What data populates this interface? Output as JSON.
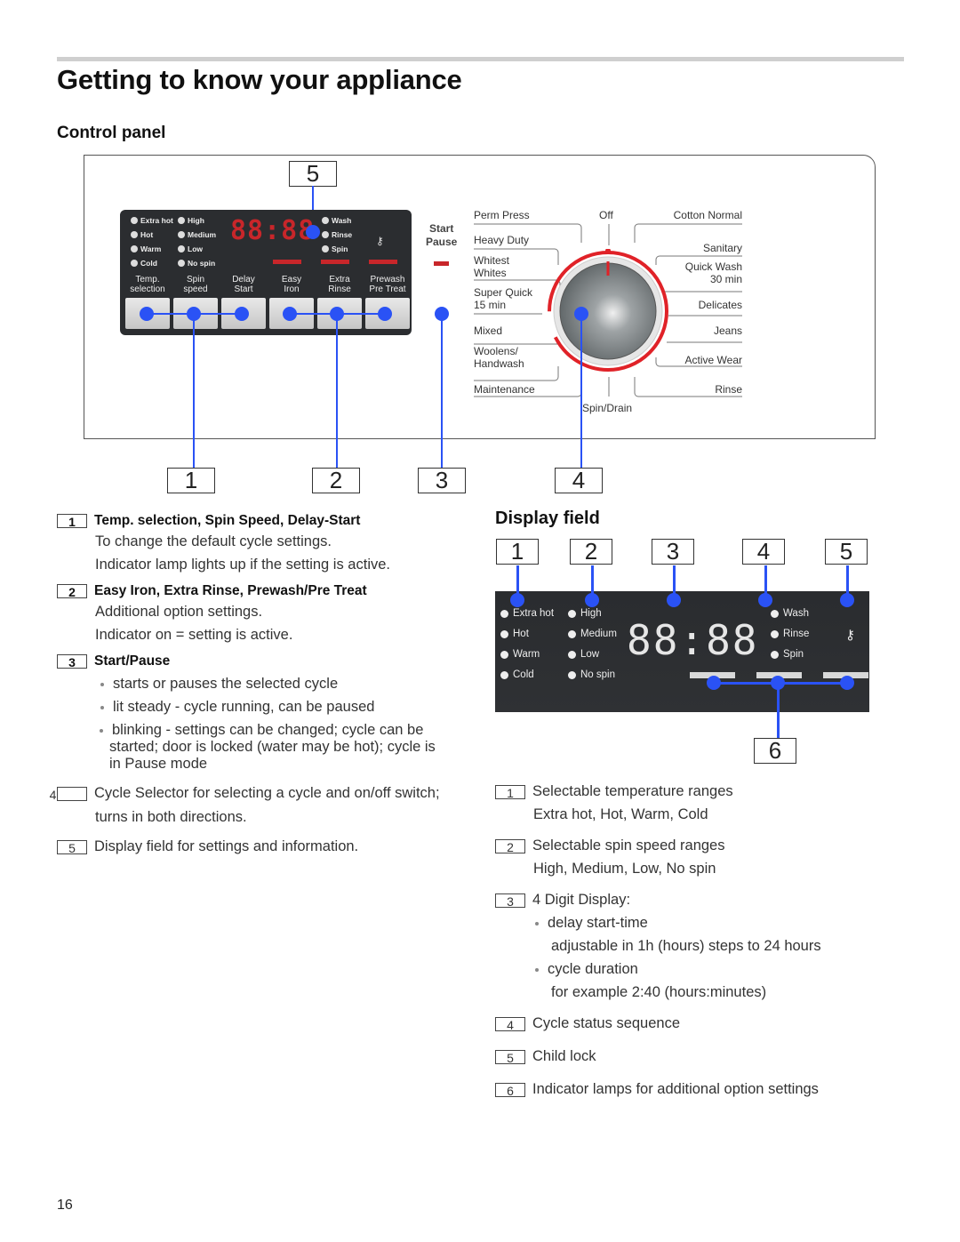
{
  "page": {
    "title": "Getting to know your appliance",
    "page_number": "16"
  },
  "control_panel": {
    "heading": "Control panel",
    "temp_lamps": [
      "Extra hot",
      "Hot",
      "Warm",
      "Cold"
    ],
    "spin_lamps": [
      "High",
      "Medium",
      "Low",
      "No spin"
    ],
    "status_lamps": [
      "Wash",
      "Rinse",
      "Spin"
    ],
    "display_digits": "88:88",
    "buttons": [
      {
        "line1": "Temp.",
        "line2": "selection"
      },
      {
        "line1": "Spin",
        "line2": "speed"
      },
      {
        "line1": "Delay",
        "line2": "Start"
      },
      {
        "line1": "Easy",
        "line2": "Iron"
      },
      {
        "line1": "Extra",
        "line2": "Rinse"
      },
      {
        "line1": "Prewash",
        "line2": "Pre Treat"
      }
    ],
    "start_pause": {
      "line1": "Start",
      "line2": "Pause"
    },
    "cycles_left": [
      {
        "line1": "Perm Press",
        "line2": ""
      },
      {
        "line1": "Heavy Duty",
        "line2": ""
      },
      {
        "line1": "Whitest",
        "line2": "Whites"
      },
      {
        "line1": "Super Quick",
        "line2": "15 min"
      },
      {
        "line1": "Mixed",
        "line2": ""
      },
      {
        "line1": "Woolens/",
        "line2": "Handwash"
      },
      {
        "line1": "Maintenance",
        "line2": ""
      }
    ],
    "cycles_right": [
      {
        "line1": "Cotton Normal",
        "line2": ""
      },
      {
        "line1": "Sanitary",
        "line2": ""
      },
      {
        "line1": "Quick Wash",
        "line2": "30 min"
      },
      {
        "line1": "Delicates",
        "line2": ""
      },
      {
        "line1": "Jeans",
        "line2": ""
      },
      {
        "line1": "Active Wear",
        "line2": ""
      },
      {
        "line1": "Rinse",
        "line2": ""
      }
    ],
    "cycle_off": "Off",
    "cycle_spin_drain": "Spin/Drain",
    "callouts": [
      "1",
      "2",
      "3",
      "4",
      "5"
    ],
    "colors": {
      "accent_red": "#c8262a",
      "callout_blue": "#2a52f5",
      "panel_dark": "#2b2d30"
    }
  },
  "left_items": [
    {
      "num": "1",
      "title": "Temp. selection, Spin Speed, Delay-Start",
      "lines": [
        "To change the default cycle settings.",
        "Indicator lamp lights up if the setting is active."
      ]
    },
    {
      "num": "2",
      "title": "Easy Iron, Extra Rinse, Prewash/Pre Treat",
      "lines": [
        "Additional option settings.",
        "Indicator on = setting is active."
      ]
    },
    {
      "num": "3",
      "title": "Start/Pause",
      "bullets": [
        "starts or pauses the selected cycle",
        "lit steady - cycle running, can be paused",
        "blinking - settings can be changed; cycle can be started; door is locked (water may be hot); cycle is in Pause mode"
      ]
    },
    {
      "num": "4",
      "text": "Cycle Selector for selecting a cycle and on/off switch;",
      "lines": [
        "turns in both directions."
      ]
    },
    {
      "num": "5",
      "text": "Display field for settings and information."
    }
  ],
  "display_field": {
    "heading": "Display field",
    "callouts": [
      "1",
      "2",
      "3",
      "4",
      "5",
      "6"
    ],
    "temp_lamps": [
      "Extra hot",
      "Hot",
      "Warm",
      "Cold"
    ],
    "spin_lamps": [
      "High",
      "Medium",
      "Low",
      "No spin"
    ],
    "status_lamps": [
      "Wash",
      "Rinse",
      "Spin"
    ],
    "digits": "88:88"
  },
  "right_items": [
    {
      "num": "1",
      "text": "Selectable temperature ranges",
      "lines": [
        "Extra hot, Hot, Warm, Cold"
      ]
    },
    {
      "num": "2",
      "text": "Selectable spin speed ranges",
      "lines": [
        "High, Medium, Low, No spin"
      ]
    },
    {
      "num": "3",
      "text": "4 Digit Display:",
      "bullet1": "delay start-time",
      "bullet1_sub": "adjustable in 1h (hours) steps to 24 hours",
      "bullet2": "cycle duration",
      "bullet2_sub": "for example 2:40 (hours:minutes)"
    },
    {
      "num": "4",
      "text": "Cycle status sequence"
    },
    {
      "num": "5",
      "text": "Child lock"
    },
    {
      "num": "6",
      "text": "Indicator lamps for additional option settings"
    }
  ]
}
